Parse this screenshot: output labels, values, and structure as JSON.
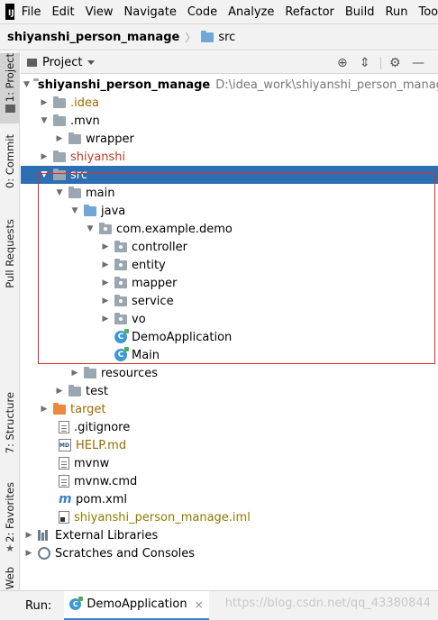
{
  "menubar": {
    "logo_text": "IJ",
    "items": [
      "File",
      "Edit",
      "View",
      "Navigate",
      "Code",
      "Analyze",
      "Refactor",
      "Build",
      "Run",
      "Tools"
    ]
  },
  "navbar": {
    "project": "shiyanshi_person_manage",
    "folder": "src"
  },
  "stripe": {
    "project_tab": "1: Project",
    "commit_tab": "0: Commit",
    "pull_requests_tab": "Pull Requests",
    "structure_tab": "7: Structure",
    "favorites_tab": "2: Favorites",
    "web_tab": "Web"
  },
  "panel": {
    "title": "Project",
    "buttons": [
      "crosshair-icon",
      "collapse-icon",
      "gear-icon",
      "hide-icon"
    ]
  },
  "tree": {
    "root_name": "shiyanshi_person_manage",
    "root_path": "D:\\idea_work\\shiyanshi_person_manage",
    "idea": ".idea",
    "mvn": ".mvn",
    "wrapper": "wrapper",
    "shiyanshi": "shiyanshi",
    "src": "src",
    "main": "main",
    "java": "java",
    "package": "com.example.demo",
    "controller": "controller",
    "entity": "entity",
    "mapper": "mapper",
    "service": "service",
    "vo": "vo",
    "demo_application": "DemoApplication",
    "main_class": "Main",
    "resources": "resources",
    "test": "test",
    "target": "target",
    "gitignore": ".gitignore",
    "help_md": "HELP.md",
    "md_badge": "MD",
    "mvnw": "mvnw",
    "mvnw_cmd": "mvnw.cmd",
    "pom": "pom.xml",
    "iml": "shiyanshi_person_manage.iml",
    "external_libraries": "External Libraries",
    "scratches": "Scratches and Consoles"
  },
  "runbar": {
    "label": "Run:",
    "tab_label": "DemoApplication",
    "close": "×"
  },
  "watermark": "https://blog.csdn.net/qq_43380844",
  "colors": {
    "selection": "#2d6fb2",
    "highlight_box": "#d9302c",
    "excluded_red": "#c0392b"
  }
}
